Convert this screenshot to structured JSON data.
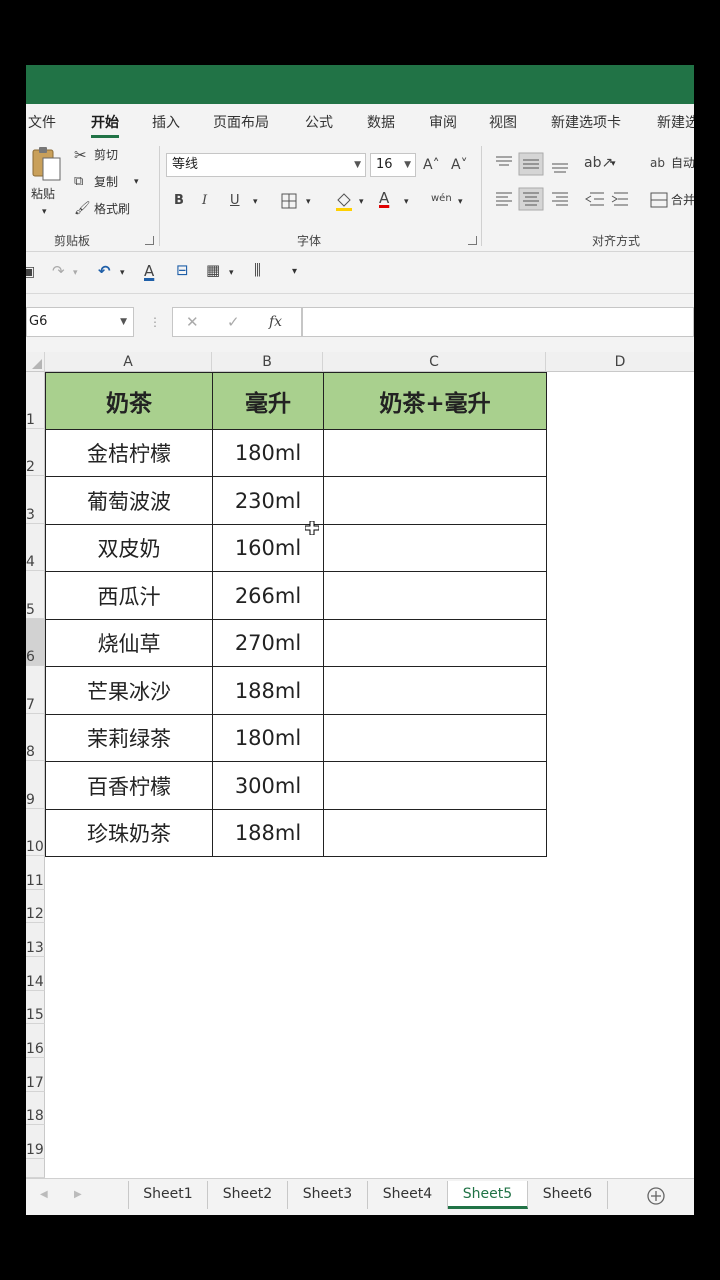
{
  "ribbon_tabs": [
    "文件",
    "开始",
    "插入",
    "页面布局",
    "公式",
    "数据",
    "审阅",
    "视图",
    "新建选项卡",
    "新建选"
  ],
  "active_tab_index": 1,
  "clipboard": {
    "paste": "粘贴",
    "cut": "剪切",
    "copy": "复制",
    "format_painter": "格式刷",
    "group_label": "剪贴板"
  },
  "font": {
    "family": "等线",
    "size": "16",
    "bold": "B",
    "italic": "I",
    "underline": "U",
    "grow": "A˄",
    "shrink": "A˅",
    "font_color": "A",
    "phonetic": "wén",
    "group_label": "字体"
  },
  "alignment": {
    "wrap": "自动",
    "merge": "合并",
    "group_label": "对齐方式"
  },
  "name_box": "G6",
  "column_headers": [
    "A",
    "B",
    "C",
    "D"
  ],
  "row_numbers": [
    "1",
    "2",
    "3",
    "4",
    "5",
    "6",
    "7",
    "8",
    "9",
    "10",
    "11",
    "12",
    "13",
    "14",
    "15",
    "16",
    "17",
    "18",
    "19"
  ],
  "selected_row": "6",
  "table": {
    "headers": [
      "奶茶",
      "毫升",
      "奶茶+毫升"
    ],
    "rows": [
      [
        "金桔柠檬",
        "180ml",
        ""
      ],
      [
        "葡萄波波",
        "230ml",
        ""
      ],
      [
        "双皮奶",
        "160ml",
        ""
      ],
      [
        "西瓜汁",
        "266ml",
        ""
      ],
      [
        "烧仙草",
        "270ml",
        ""
      ],
      [
        "芒果冰沙",
        "188ml",
        ""
      ],
      [
        "茉莉绿茶",
        "180ml",
        ""
      ],
      [
        "百香柠檬",
        "300ml",
        ""
      ],
      [
        "珍珠奶茶",
        "188ml",
        ""
      ]
    ]
  },
  "sheets": [
    "Sheet1",
    "Sheet2",
    "Sheet3",
    "Sheet4",
    "Sheet5",
    "Sheet6"
  ],
  "active_sheet_index": 4,
  "colors": {
    "excel_green": "#217346",
    "header_fill": "#a9d08e"
  }
}
